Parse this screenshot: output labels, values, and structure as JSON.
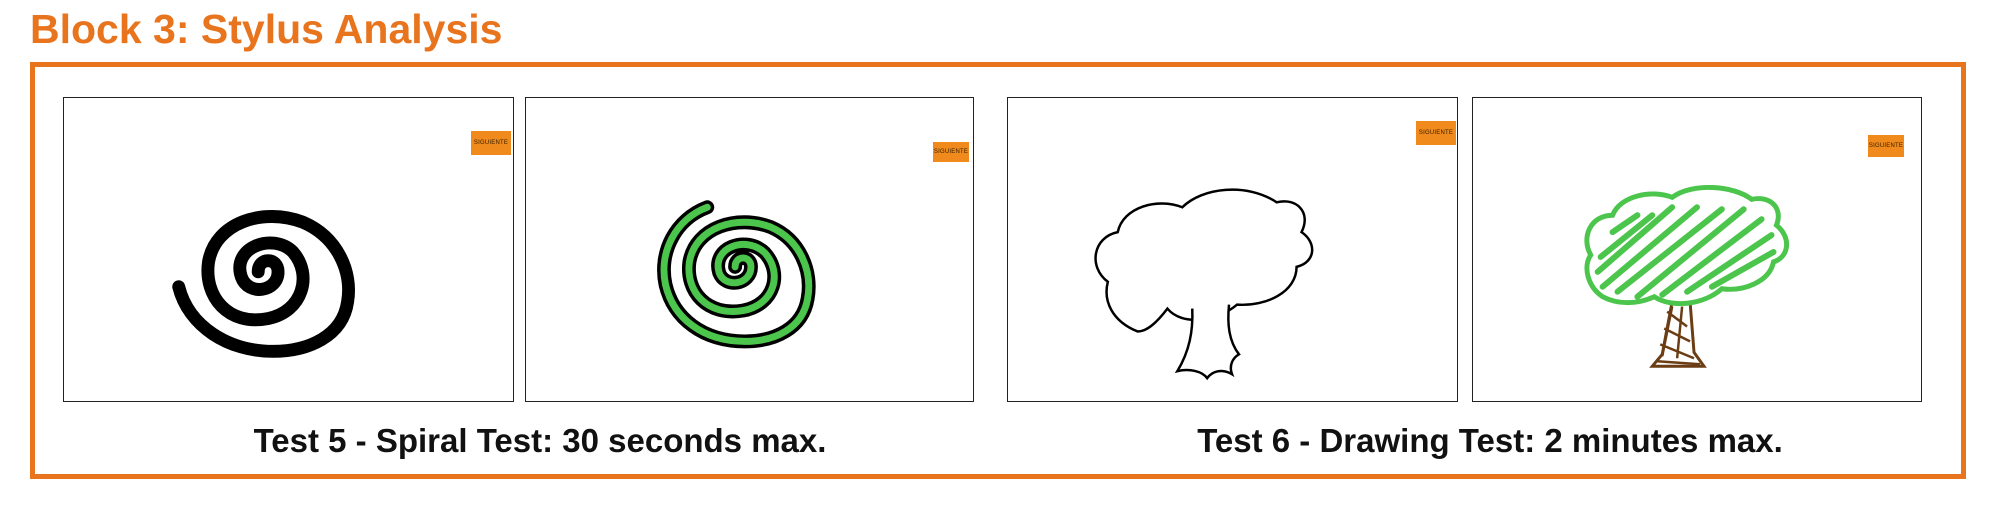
{
  "block": {
    "title": "Block 3: Stylus Analysis"
  },
  "colors": {
    "accent": "#e8741e",
    "stroke_green": "#4cc54c",
    "trunk_brown": "#6b3d14"
  },
  "panels": [
    {
      "name": "spiral-template",
      "drawing": "spiral",
      "traced": false,
      "button_label": "SIGUIENTE"
    },
    {
      "name": "spiral-traced",
      "drawing": "spiral",
      "traced": true,
      "button_label": "SIGUIENTE"
    },
    {
      "name": "tree-template",
      "drawing": "tree",
      "traced": false,
      "button_label": "SIGUIENTE"
    },
    {
      "name": "tree-traced",
      "drawing": "tree",
      "traced": true,
      "button_label": "SIGUIENTE"
    }
  ],
  "captions": {
    "test5": "Test 5 - Spiral Test: 30 seconds max.",
    "test6": "Test 6 - Drawing Test: 2 minutes max."
  }
}
